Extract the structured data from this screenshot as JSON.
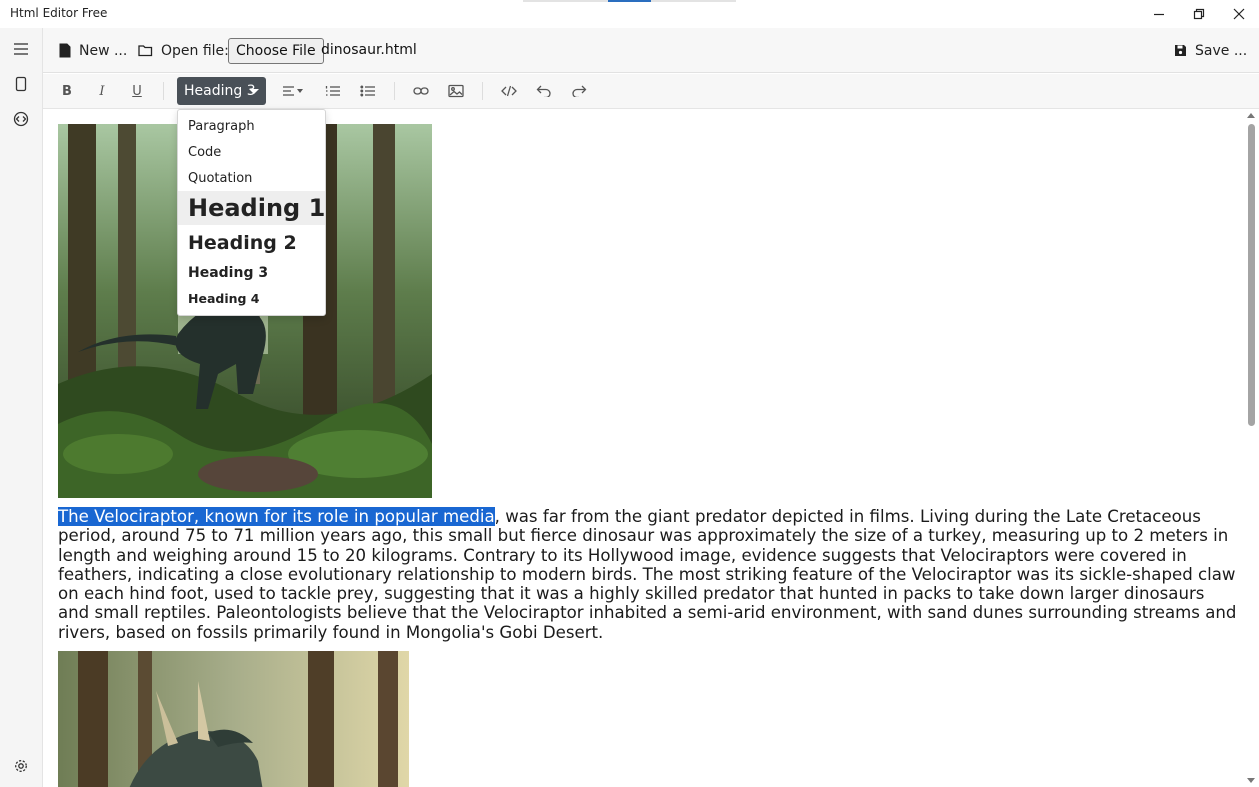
{
  "window": {
    "title": "Html Editor Free",
    "controls": [
      "minimize-icon",
      "restore-icon",
      "close-icon"
    ]
  },
  "rail": {
    "icons": [
      "menu-icon",
      "page-icon",
      "source-icon",
      "settings-icon"
    ]
  },
  "filebar": {
    "new_label": "New ...",
    "open_label": "Open file:",
    "choose_label": "Choose File",
    "file_name": "dinosaur.html",
    "save_label": "Save ..."
  },
  "toolbar": {
    "bold": "B",
    "italic": "I",
    "underline": "U",
    "block_format": "Heading 3"
  },
  "dropdown": {
    "items": [
      "Paragraph",
      "Code",
      "Quotation",
      "Heading 1",
      "Heading 2",
      "Heading 3",
      "Heading 4"
    ],
    "highlighted": "Heading 1"
  },
  "content": {
    "selected_text": "The Velociraptor, known for its role in popular media",
    "rest_text": ", was far from the giant predator depicted in films. Living during the Late Cretaceous period, around 75 to 71 million years ago, this small but fierce dinosaur was approximately the size of a turkey, measuring up to 2 meters in length and weighing around 15 to 20 kilograms. Contrary to its Hollywood image, evidence suggests that Velociraptors were covered in feathers, indicating a close evolutionary relationship to modern birds. The most striking feature of the Velociraptor was its sickle-shaped claw on each hind foot, used to tackle prey, suggesting that it was a highly skilled predator that hunted in packs to take down larger dinosaurs and small reptiles. Paleontologists believe that the Velociraptor inhabited a semi-arid environment, with sand dunes surrounding streams and rivers, based on fossils primarily found in Mongolia's Gobi Desert."
  },
  "colors": {
    "selection": "#1967d2",
    "select_bg": "#495057",
    "accent": "#2a6ebf"
  }
}
